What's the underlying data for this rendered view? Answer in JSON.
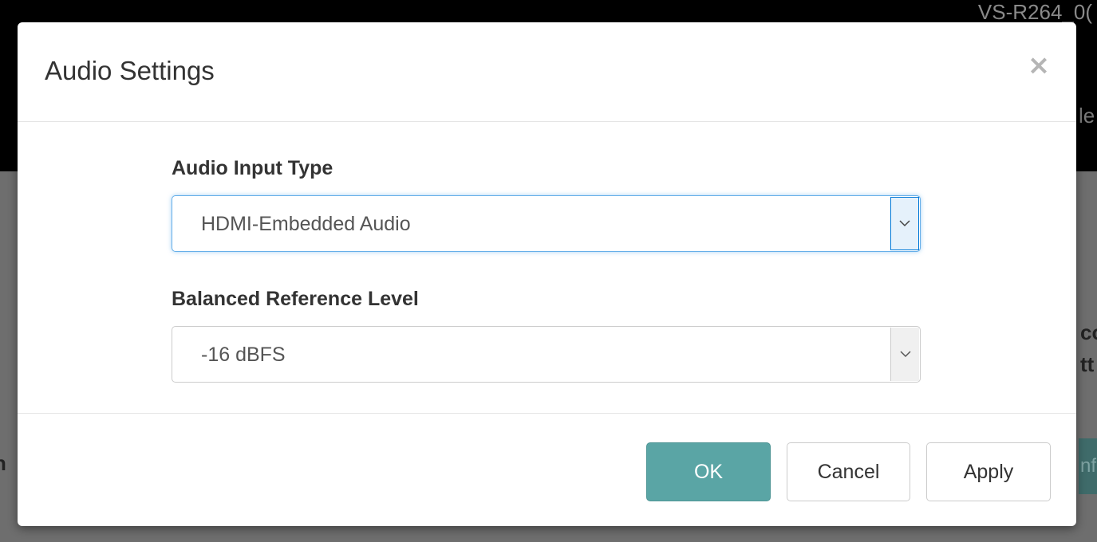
{
  "background": {
    "device_name": "VS-R264_0(",
    "fragments": [
      "le",
      "co",
      "tt",
      "n",
      "nf"
    ]
  },
  "modal": {
    "title": "Audio Settings",
    "close_glyph": "×",
    "fields": {
      "audio_input_type": {
        "label": "Audio Input Type",
        "value": "HDMI-Embedded Audio"
      },
      "balanced_reference_level": {
        "label": "Balanced Reference Level",
        "value": "-16 dBFS"
      }
    },
    "buttons": {
      "ok": "OK",
      "cancel": "Cancel",
      "apply": "Apply"
    }
  },
  "icons": {
    "dropdown": "chevron-down-icon"
  },
  "colors": {
    "primary_button": "#5aa5a5",
    "focus_border": "#66afe9"
  }
}
